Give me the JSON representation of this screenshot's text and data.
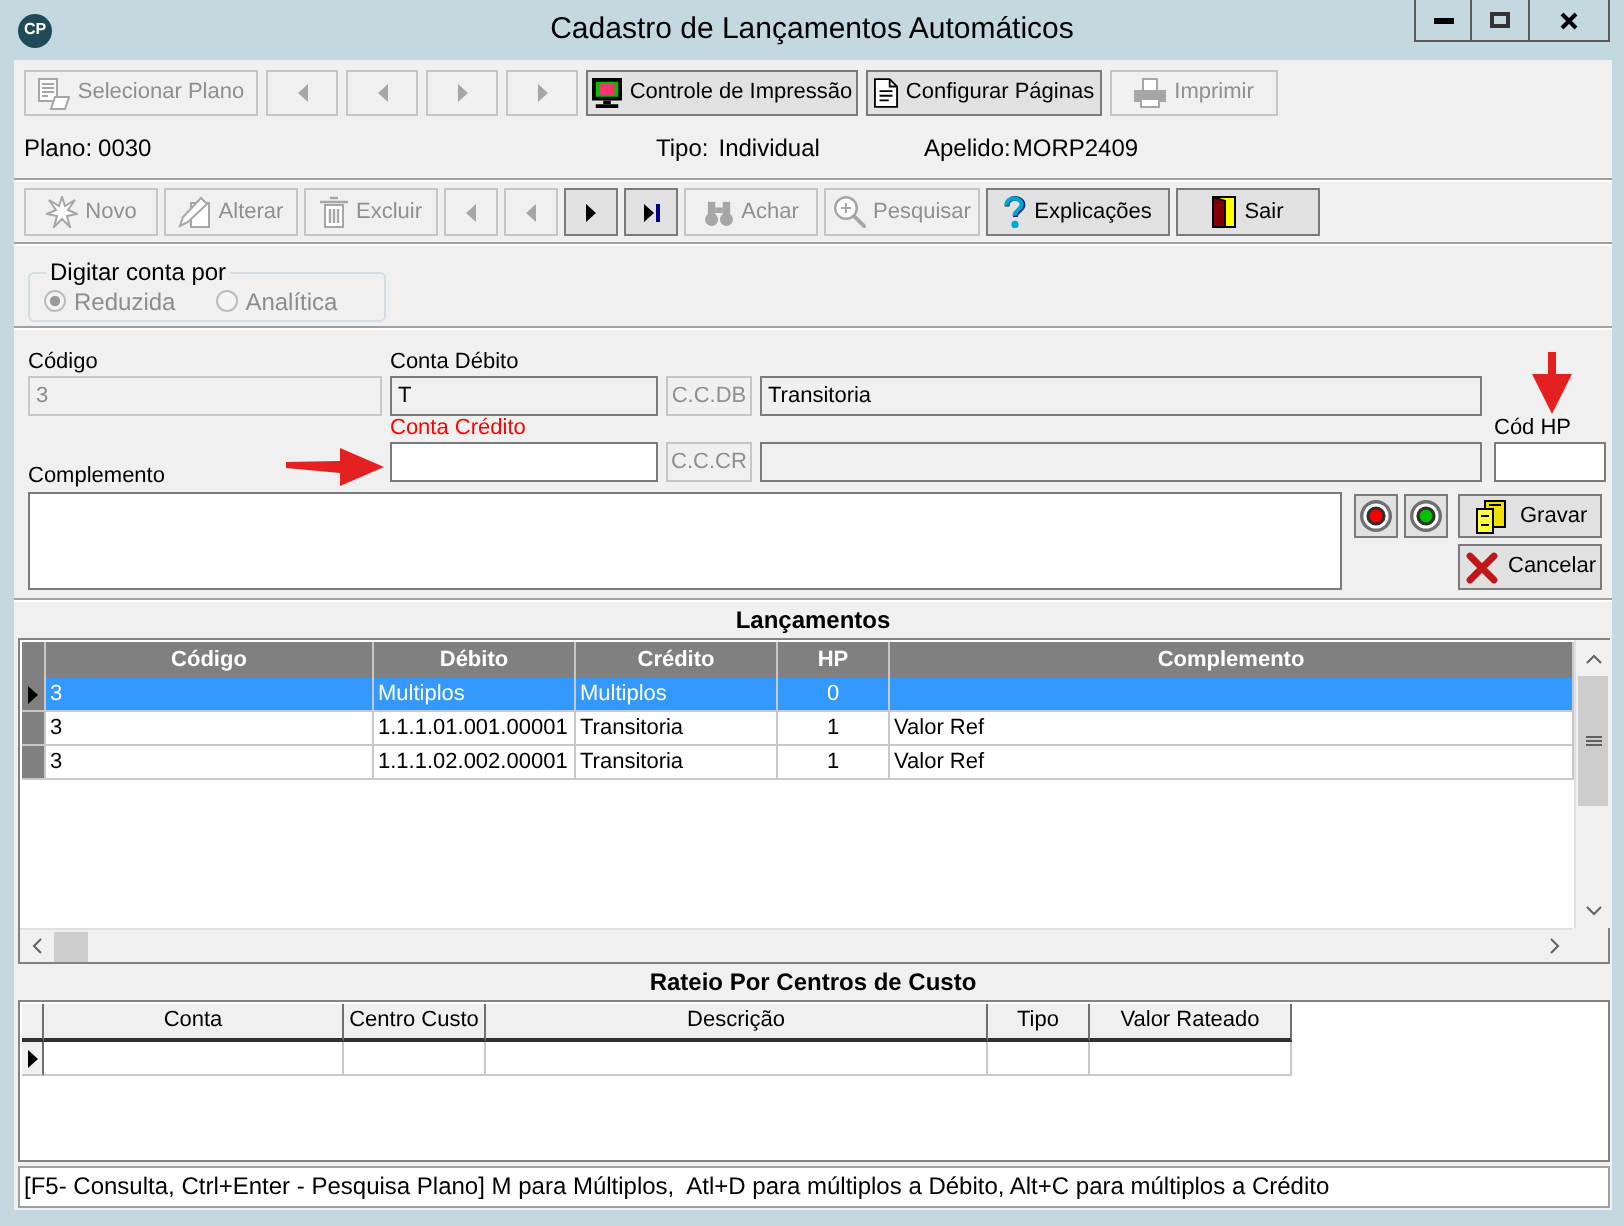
{
  "window": {
    "logo": "CP",
    "title": "Cadastro de Lançamentos Automáticos"
  },
  "toolbar_top": [
    {
      "kind": "text",
      "label": "Selecionar Plano",
      "disabled": true
    },
    {
      "kind": "back",
      "disabled": true
    },
    {
      "kind": "back",
      "disabled": true
    },
    {
      "kind": "forward",
      "disabled": true
    },
    {
      "kind": "forward",
      "disabled": true
    },
    {
      "kind": "text",
      "label": "Controle de Impressão",
      "disabled": false
    },
    {
      "kind": "text",
      "label": "Configurar Páginas",
      "disabled": false
    },
    {
      "kind": "text",
      "label": "Imprimir",
      "disabled": true
    }
  ],
  "info": {
    "plano": {
      "label": "Plano:",
      "value": "0030"
    },
    "tipo": {
      "label": "Tipo:",
      "value": "Individual"
    },
    "apelido": {
      "label": "Apelido:",
      "value": "MORP2409"
    }
  },
  "toolbar_record": [
    {
      "kind": "text",
      "label": "Novo",
      "disabled": true
    },
    {
      "kind": "text",
      "label": "Alterar",
      "disabled": true
    },
    {
      "kind": "text",
      "label": "Excluir",
      "disabled": true
    },
    {
      "kind": "back",
      "disabled": true
    },
    {
      "kind": "back",
      "disabled": true
    },
    {
      "kind": "forward",
      "disabled": false
    },
    {
      "kind": "last",
      "disabled": false
    },
    {
      "kind": "text",
      "label": "Achar",
      "disabled": true
    },
    {
      "kind": "text",
      "label": "Pesquisar",
      "disabled": true
    },
    {
      "kind": "text",
      "label": "Explicações",
      "disabled": false
    },
    {
      "kind": "text",
      "label": "Sair",
      "disabled": false
    }
  ],
  "entry_mode": {
    "title": "Digitar conta por",
    "disabled": true,
    "options": [
      {
        "label": "Reduzida",
        "selected": true
      },
      {
        "label": "Analítica",
        "selected": false
      }
    ]
  },
  "form": {
    "codigo": {
      "label": "Código",
      "value": "3",
      "disabled": true
    },
    "conta_debito": {
      "label": "Conta Débito",
      "value": "T",
      "highlighted": false,
      "editable": false,
      "button": {
        "label": "C.C.DB",
        "disabled": true
      },
      "description": "Transitoria"
    },
    "conta_credito": {
      "label": "Conta Crédito",
      "highlighted": true,
      "editable": true,
      "annotated": true,
      "button": {
        "label": "C.C.CR",
        "disabled": true
      }
    },
    "cod_hp": {
      "label": "Cód HP",
      "annotated": true
    },
    "complemento": {
      "label": "Complemento"
    }
  },
  "marker_buttons": [
    {
      "color": "#ff0000"
    },
    {
      "color": "#00c000"
    }
  ],
  "actions": [
    {
      "label": "Gravar"
    },
    {
      "label": "Cancelar"
    }
  ],
  "lancamentos": {
    "title": "Lançamentos",
    "columns": [
      "Código",
      "Débito",
      "Crédito",
      "HP",
      "Complemento"
    ],
    "rows": [
      {
        "codigo": "3",
        "debito": "Multiplos",
        "credito": "Multiplos",
        "hp": "0",
        "selected": true
      },
      {
        "codigo": "3",
        "debito": "1.1.1.01.001.00001",
        "credito": "Transitoria",
        "hp": "1",
        "complemento": "Valor Ref",
        "selected": false
      },
      {
        "codigo": "3",
        "debito": "1.1.1.02.002.00001",
        "credito": "Transitoria",
        "hp": "1",
        "complemento": "Valor Ref",
        "selected": false
      }
    ]
  },
  "rateio": {
    "title": "Rateio Por Centros de Custo",
    "columns": [
      "Conta",
      "Centro Custo",
      "Descrição",
      "Tipo",
      "Valor Rateado"
    ],
    "rows": [
      {
        "selected": true
      }
    ]
  },
  "status_bar": "[F5- Consulta, Ctrl+Enter - Pesquisa Plano] M para Múltiplos,  Atl+D para múltiplos a Débito, Alt+C para múltiplos a Crédito"
}
